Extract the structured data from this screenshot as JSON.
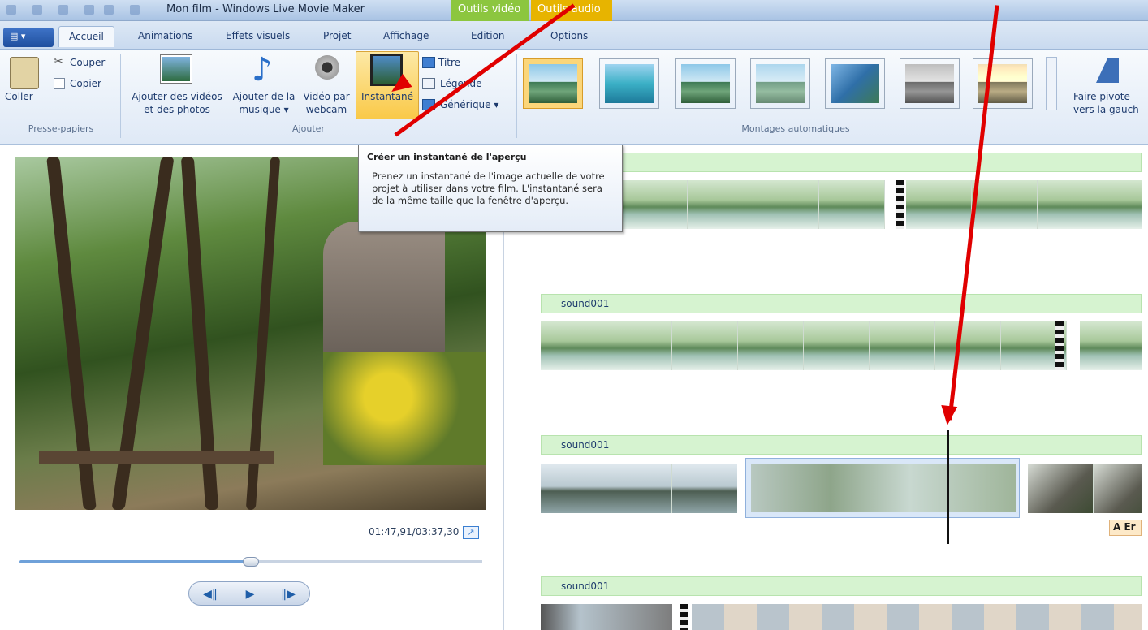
{
  "titlebar": {
    "title": "Mon film - Windows Live Movie Maker",
    "ctx_video": "Outils vidéo",
    "ctx_audio": "Outils audio"
  },
  "tabs": {
    "file_label": "▤ ▾",
    "items": [
      "Accueil",
      "Animations",
      "Effets visuels",
      "Projet",
      "Affichage",
      "Edition",
      "Options"
    ],
    "active": "Accueil"
  },
  "ribbon": {
    "clipboard": {
      "paste": "Coller",
      "cut": "Couper",
      "copy": "Copier",
      "group": "Presse-papiers"
    },
    "add": {
      "add_media_line1": "Ajouter des vidéos",
      "add_media_line2": "et des photos",
      "add_music_line1": "Ajouter de la",
      "add_music_line2": "musique ▾",
      "webcam_line1": "Vidéo par",
      "webcam_line2": "webcam",
      "snapshot": "Instantané",
      "title": "Titre",
      "caption": "Légende",
      "credits": "Générique ▾",
      "group": "Ajouter"
    },
    "automovie": {
      "group": "Montages automatiques"
    },
    "rotate": {
      "line1": "Faire pivote",
      "line2": "vers la gauch"
    }
  },
  "tooltip": {
    "title": "Créer un instantané de l'aperçu",
    "body": "Prenez un instantané de l'image actuelle de votre projet à utiliser dans votre film. L'instantané sera de la même taille que la fenêtre d'aperçu."
  },
  "player": {
    "time": "01:47,91/03:37,30",
    "progress": 0.5,
    "prev_icon": "◀‖",
    "play_icon": "▶",
    "next_icon": "‖▶"
  },
  "timeline": {
    "audio_tracks": [
      "sound001",
      "sound001",
      "sound001"
    ],
    "caption_chip": "A Er"
  },
  "colors": {
    "ribbon_accent": "#2b5797",
    "ctx_video": "#8cc63f",
    "ctx_audio": "#e7b400",
    "audio_bar": "#d6f3d0",
    "arrow": "#e00000"
  }
}
